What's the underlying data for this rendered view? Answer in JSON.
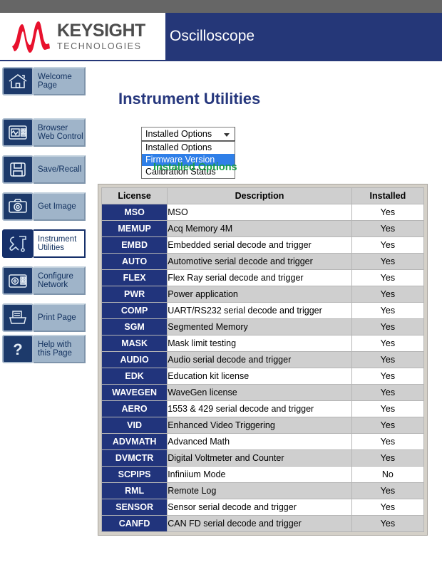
{
  "banner": {
    "logo_brand": "KEYSIGHT",
    "logo_sub": "TECHNOLOGIES",
    "title": "Oscilloscope",
    "brand_red": "#e8112d",
    "banner_blue": "#253778"
  },
  "sidebar": {
    "items": [
      {
        "label_line1": "Welcome",
        "label_line2": "Page",
        "icon": "home-icon",
        "selected": false
      },
      {
        "label_line1": "Browser",
        "label_line2": "Web Control",
        "icon": "monitor-icon",
        "selected": false
      },
      {
        "label_line1": "Save/Recall",
        "label_line2": "",
        "icon": "floppy-disk-icon",
        "selected": false
      },
      {
        "label_line1": "Get Image",
        "label_line2": "",
        "icon": "camera-icon",
        "selected": false
      },
      {
        "label_line1": "Instrument",
        "label_line2": "Utilities",
        "icon": "wrench-icon",
        "selected": true
      },
      {
        "label_line1": "Configure",
        "label_line2": "Network",
        "icon": "network-icon",
        "selected": false
      },
      {
        "label_line1": "Print Page",
        "label_line2": "",
        "icon": "printer-icon",
        "selected": false
      },
      {
        "label_line1": "Help with",
        "label_line2": "this Page",
        "icon": "question-icon",
        "selected": false
      }
    ]
  },
  "main": {
    "page_title": "Instrument Utilities",
    "subtitle": "Installed Options",
    "subtitle_color": "#1a9e4b",
    "utility_select": {
      "selected": "Installed Options",
      "expanded": true,
      "highlighted": "Firmware Version",
      "options": [
        "Installed Options",
        "Firmware Version",
        "Calibration Status"
      ]
    },
    "table": {
      "columns": [
        "License",
        "Description",
        "Installed"
      ],
      "rows": [
        {
          "license": "MSO",
          "description": "MSO",
          "installed": "Yes"
        },
        {
          "license": "MEMUP",
          "description": "Acq Memory 4M",
          "installed": "Yes"
        },
        {
          "license": "EMBD",
          "description": "Embedded serial decode and trigger",
          "installed": "Yes"
        },
        {
          "license": "AUTO",
          "description": "Automotive serial decode and trigger",
          "installed": "Yes"
        },
        {
          "license": "FLEX",
          "description": "Flex Ray serial decode and trigger",
          "installed": "Yes"
        },
        {
          "license": "PWR",
          "description": "Power application",
          "installed": "Yes"
        },
        {
          "license": "COMP",
          "description": "UART/RS232 serial decode and trigger",
          "installed": "Yes"
        },
        {
          "license": "SGM",
          "description": "Segmented Memory",
          "installed": "Yes"
        },
        {
          "license": "MASK",
          "description": "Mask limit testing",
          "installed": "Yes"
        },
        {
          "license": "AUDIO",
          "description": "Audio serial decode and trigger",
          "installed": "Yes"
        },
        {
          "license": "EDK",
          "description": "Education kit license",
          "installed": "Yes"
        },
        {
          "license": "WAVEGEN",
          "description": "WaveGen license",
          "installed": "Yes"
        },
        {
          "license": "AERO",
          "description": "1553 & 429 serial decode and trigger",
          "installed": "Yes"
        },
        {
          "license": "VID",
          "description": "Enhanced Video Triggering",
          "installed": "Yes"
        },
        {
          "license": "ADVMATH",
          "description": "Advanced Math",
          "installed": "Yes"
        },
        {
          "license": "DVMCTR",
          "description": "Digital Voltmeter and Counter",
          "installed": "Yes"
        },
        {
          "license": "SCPIPS",
          "description": "Infiniium Mode",
          "installed": "No"
        },
        {
          "license": "RML",
          "description": "Remote Log",
          "installed": "Yes"
        },
        {
          "license": "SENSOR",
          "description": "Sensor serial decode and trigger",
          "installed": "Yes"
        },
        {
          "license": "CANFD",
          "description": "CAN FD serial decode and trigger",
          "installed": "Yes"
        }
      ]
    }
  }
}
